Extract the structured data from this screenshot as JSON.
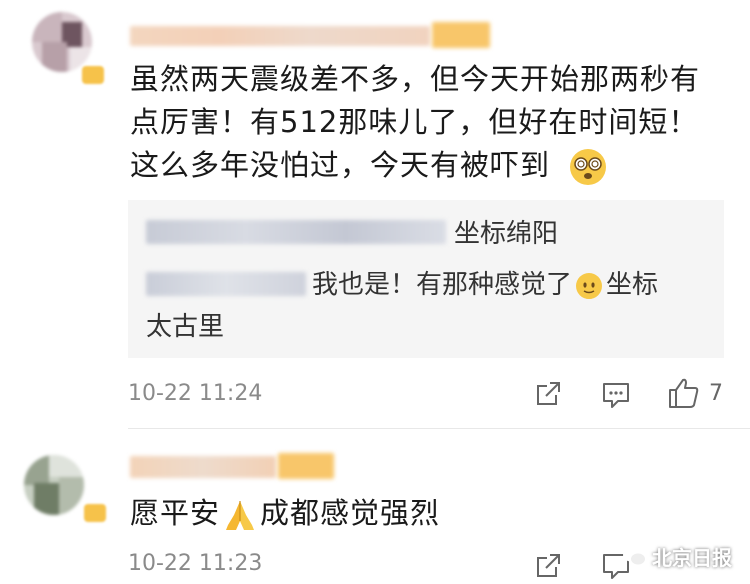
{
  "comments": [
    {
      "text_lines": [
        "虽然两天震级差不多，但今天开始那两秒有",
        "点厉害！有512那味儿了，但好在时间短！",
        "这么多年没怕过，今天有被吓到"
      ],
      "emoji": "dizzy-face-emoji",
      "replies": [
        {
          "text": "坐标绵阳"
        },
        {
          "text_a": "我也是！有那种感觉了",
          "emoji": "slightly-smiling-face-emoji",
          "text_b": "坐标",
          "text_c": "太古里"
        }
      ],
      "time": "10-22 11:24",
      "likes": "7"
    },
    {
      "text_a": "愿平安",
      "emoji": "praying-hands-emoji",
      "text_b": "成都感觉强烈",
      "time": "10-22 11:23"
    }
  ],
  "watermark": "北京日报",
  "icons": {
    "share": "share-icon",
    "comment": "comment-icon",
    "like": "thumbs-up-icon"
  },
  "colors": {
    "text": "#1a1a1a",
    "meta": "#8a8a8a",
    "reply_bg": "#f5f5f5",
    "badge": "#f6c24a"
  }
}
